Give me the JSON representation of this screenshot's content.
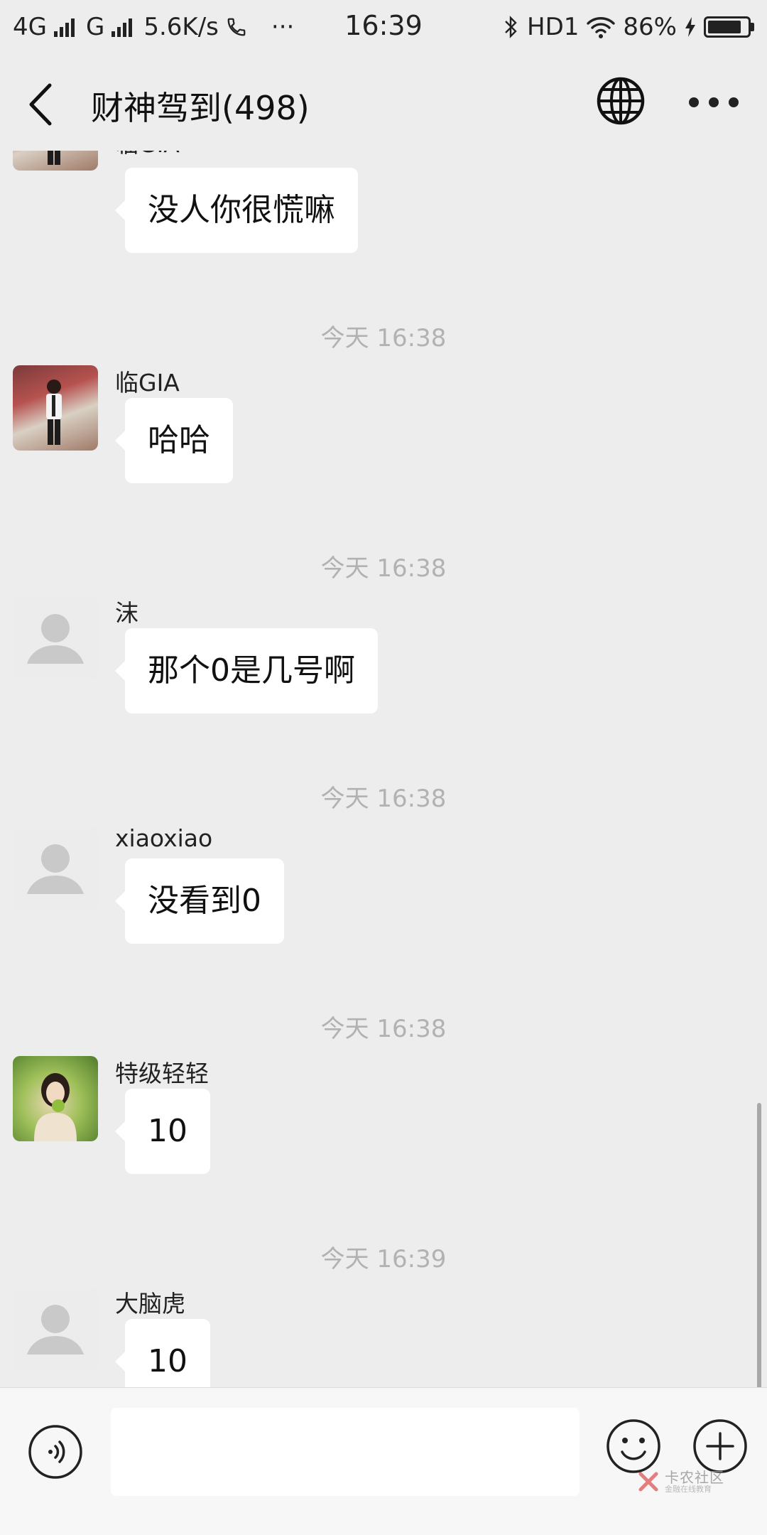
{
  "status_bar": {
    "network_1": "4G",
    "network_2": "G",
    "speed": "5.6K/s",
    "more": "···",
    "time": "16:39",
    "hd": "HD1",
    "battery": "86%",
    "battery_level": 0.86
  },
  "header": {
    "title": "财神驾到(498)",
    "back_icon": "chevron-left-icon",
    "globe_icon": "globe-icon",
    "more_icon": "more-dots-icon"
  },
  "messages": [
    {
      "type": "message",
      "sender": "临GIA",
      "avatar": "photo-man",
      "text": "没人你很慌嘛"
    },
    {
      "type": "time",
      "text": "今天 16:38"
    },
    {
      "type": "message",
      "sender": "临GIA",
      "avatar": "photo-man",
      "text": "哈哈"
    },
    {
      "type": "time",
      "text": "今天 16:38"
    },
    {
      "type": "message",
      "sender": "沫",
      "avatar": "default",
      "text": "那个0是几号啊"
    },
    {
      "type": "time",
      "text": "今天 16:38"
    },
    {
      "type": "message",
      "sender": "xiaoxiao",
      "avatar": "default",
      "text": "没看到0"
    },
    {
      "type": "time",
      "text": "今天 16:38"
    },
    {
      "type": "message",
      "sender": "特级轻轻",
      "avatar": "photo-girl",
      "text": "10"
    },
    {
      "type": "time",
      "text": "今天 16:39"
    },
    {
      "type": "message",
      "sender": "大脑虎",
      "avatar": "default",
      "text": "10"
    }
  ],
  "input_bar": {
    "value": "",
    "voice_icon": "voice-icon",
    "emoji_icon": "emoji-icon",
    "plus_icon": "plus-icon"
  },
  "watermark": {
    "name": "卡农社区",
    "sub": "金融在线教育"
  }
}
